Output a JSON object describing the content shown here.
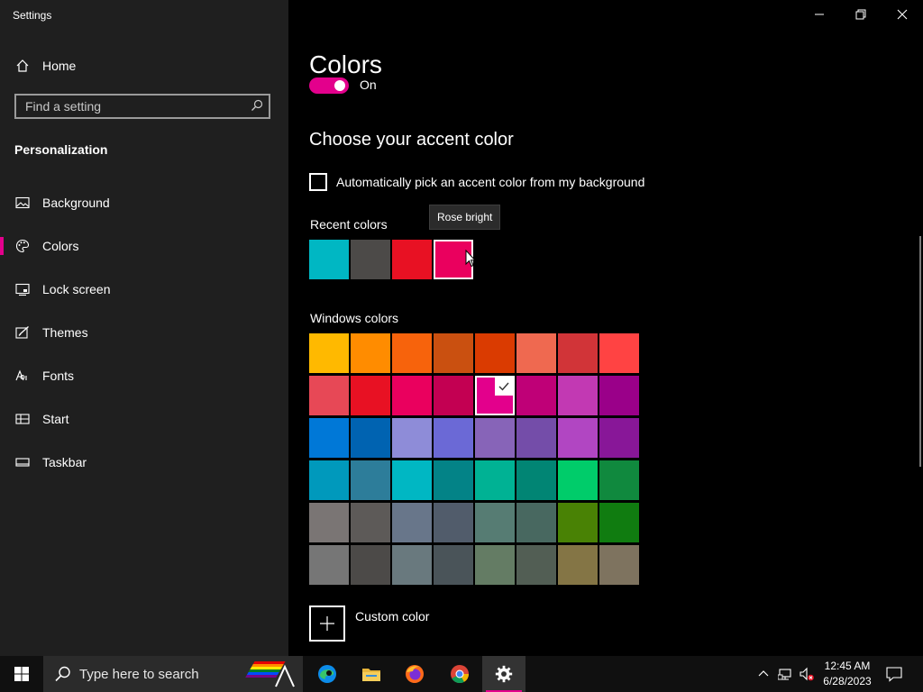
{
  "window": {
    "title": "Settings"
  },
  "sidebar": {
    "home_label": "Home",
    "search_placeholder": "Find a setting",
    "section_title": "Personalization",
    "items": [
      {
        "label": "Background",
        "icon": "image-icon"
      },
      {
        "label": "Colors",
        "icon": "palette-icon",
        "active": true
      },
      {
        "label": "Lock screen",
        "icon": "lock-screen-icon"
      },
      {
        "label": "Themes",
        "icon": "themes-icon"
      },
      {
        "label": "Fonts",
        "icon": "fonts-icon"
      },
      {
        "label": "Start",
        "icon": "start-icon"
      },
      {
        "label": "Taskbar",
        "icon": "taskbar-icon"
      }
    ]
  },
  "main": {
    "title": "Colors",
    "toggle_state": "On",
    "accent_heading": "Choose your accent color",
    "auto_pick_label": "Automatically pick an accent color from my background",
    "recent_label": "Recent colors",
    "tooltip": "Rose bright",
    "recent_colors": [
      "#00b7c3",
      "#4c4a48",
      "#e81123",
      "#ea005e"
    ],
    "windows_label": "Windows colors",
    "windows_colors": [
      [
        "#ffb900",
        "#ff8c00",
        "#f7630c",
        "#ca5010",
        "#da3b01",
        "#ef6950",
        "#d13438",
        "#ff4343"
      ],
      [
        "#e74856",
        "#e81123",
        "#ea005e",
        "#c30052",
        "#e3008c",
        "#bf0077",
        "#c239b3",
        "#9a0089"
      ],
      [
        "#0078d7",
        "#0063b1",
        "#8e8cd8",
        "#6b69d6",
        "#8764b8",
        "#744da9",
        "#b146c2",
        "#881798"
      ],
      [
        "#0099bc",
        "#2d7d9a",
        "#00b7c3",
        "#038387",
        "#00b294",
        "#018574",
        "#00cc6a",
        "#10893e"
      ],
      [
        "#7a7574",
        "#5d5a58",
        "#68768a",
        "#515c6b",
        "#567c73",
        "#486860",
        "#498205",
        "#107c10"
      ],
      [
        "#767676",
        "#4c4a48",
        "#69797e",
        "#4a5459",
        "#647c64",
        "#525e54",
        "#847545",
        "#7e735f"
      ]
    ],
    "selected_color": "#e3008c",
    "custom_label": "Custom color"
  },
  "taskbar": {
    "search_placeholder": "Type here to search",
    "apps": [
      "edge-icon",
      "file-explorer-icon",
      "firefox-icon",
      "chrome-icon",
      "settings-icon"
    ],
    "time": "12:45 AM",
    "date": "6/28/2023"
  },
  "colors": {
    "accent": "#e3008c",
    "sidebar_bg": "#1f1f1f",
    "main_bg": "#000000"
  }
}
